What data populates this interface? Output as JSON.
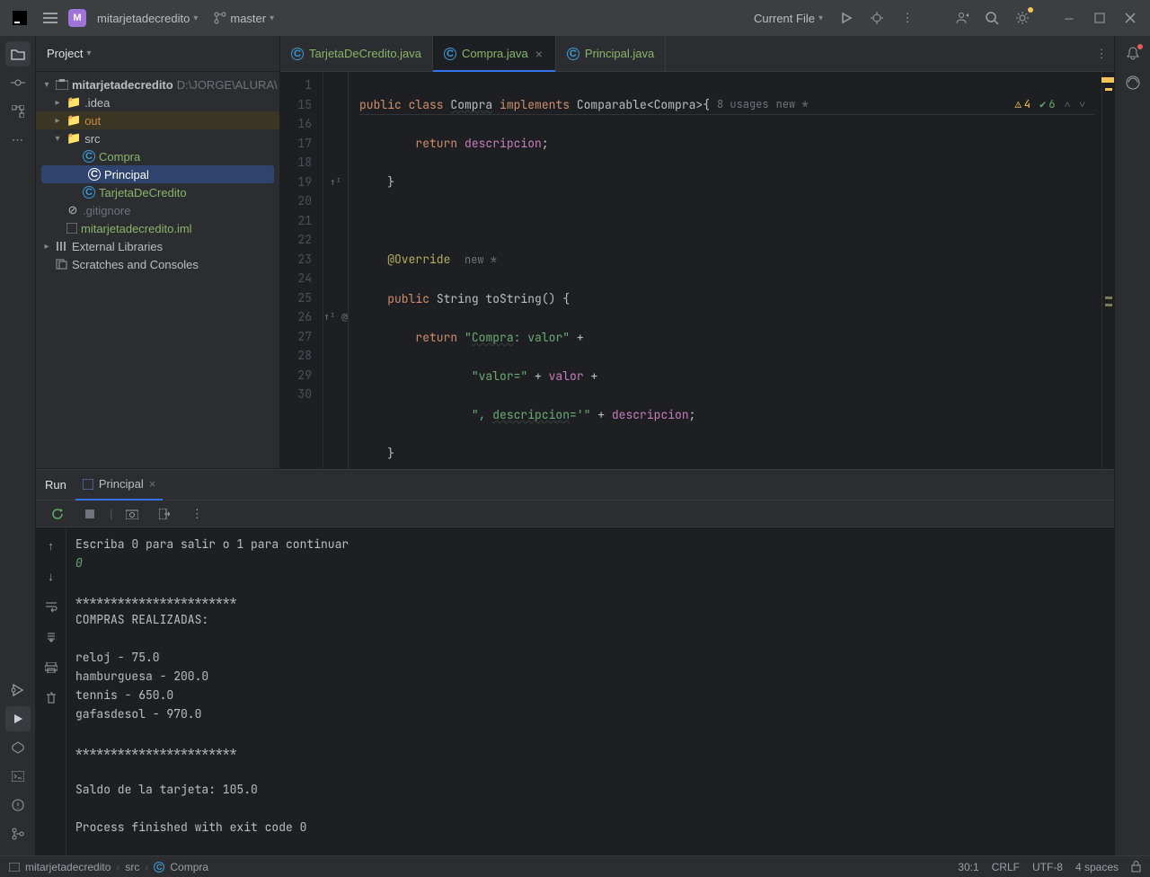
{
  "titlebar": {
    "project_badge": "M",
    "project_name": "mitarjetadecredito",
    "branch": "master",
    "run_config": "Current File"
  },
  "project_panel": {
    "title": "Project",
    "root": "mitarjetadecredito",
    "root_path": "D:\\JORGE\\ALURA\\",
    "folders": {
      "idea": ".idea",
      "out": "out",
      "src": "src"
    },
    "src_items": [
      "Compra",
      "Principal",
      "TarjetaDeCredito"
    ],
    "gitignore": ".gitignore",
    "iml": "mitarjetadecredito.iml",
    "ext_lib": "External Libraries",
    "scratches": "Scratches and Consoles"
  },
  "tabs": [
    {
      "label": "TarjetaDeCredito.java"
    },
    {
      "label": "Compra.java"
    },
    {
      "label": "Principal.java"
    }
  ],
  "sticky": {
    "pre": "public class ",
    "name": "Compra",
    "mid": " implements ",
    "impl": "Comparable<Compra>{",
    "usages": "8 usages",
    "vcs": "new *",
    "warn": "4",
    "ok": "6"
  },
  "gutter_lines": [
    "1",
    "15",
    "16",
    "17",
    "18",
    "19",
    "20",
    "21",
    "22",
    "23",
    "24",
    "25",
    "26",
    "27",
    "28",
    "29",
    "30"
  ],
  "gutter_marks": {
    "5": "↑ᴵ",
    "12": "↑ᴵ @"
  },
  "annotations": {
    "override_new": "new *"
  },
  "run": {
    "title": "Run",
    "tab": "Principal",
    "output_lines": [
      {
        "t": "Escriba 0 para salir o 1 para continuar"
      },
      {
        "t": "0",
        "cls": "inp"
      },
      {
        "t": ""
      },
      {
        "t": "***********************"
      },
      {
        "t": "COMPRAS REALIZADAS:"
      },
      {
        "t": ""
      },
      {
        "t": "reloj - 75.0"
      },
      {
        "t": "hamburguesa - 200.0"
      },
      {
        "t": "tennis - 650.0"
      },
      {
        "t": "gafasdesol - 970.0"
      },
      {
        "t": ""
      },
      {
        "t": "***********************"
      },
      {
        "t": ""
      },
      {
        "t": "Saldo de la tarjeta: 105.0"
      },
      {
        "t": ""
      },
      {
        "t": "Process finished with exit code 0"
      }
    ]
  },
  "status": {
    "crumbs": [
      "mitarjetadecredito",
      "src",
      "Compra"
    ],
    "pos": "30:1",
    "sep": "CRLF",
    "enc": "UTF-8",
    "indent": "4 spaces"
  }
}
